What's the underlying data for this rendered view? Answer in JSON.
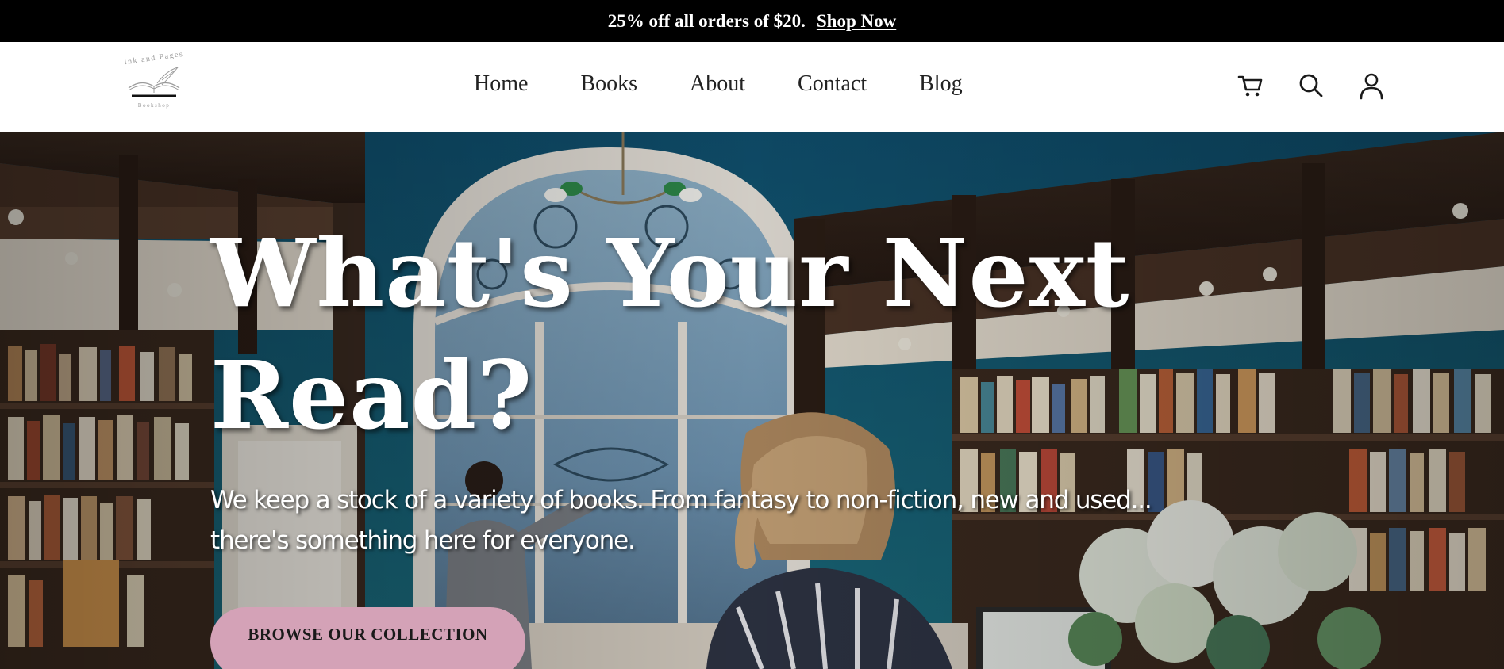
{
  "promo": {
    "text": "25% off all orders of $20.",
    "link": "Shop Now"
  },
  "header": {
    "logo": {
      "top_text": "Ink and Pages",
      "bottom_text": "Bookshop"
    },
    "nav": [
      {
        "label": "Home"
      },
      {
        "label": "Books"
      },
      {
        "label": "About"
      },
      {
        "label": "Contact"
      },
      {
        "label": "Blog"
      }
    ],
    "icons": [
      "cart-icon",
      "search-icon",
      "account-icon"
    ]
  },
  "hero": {
    "title_line1": "What's Your Next",
    "title_line2": "Read?",
    "subtitle_line1": "We keep a stock of a variety of books. From fantasy to non-fiction, new and used...",
    "subtitle_line2": "there's something here for everyone.",
    "button": "BROWSE OUR COLLECTION"
  },
  "colors": {
    "promo_bg": "#000000",
    "button_bg": "#d4a2b7",
    "text_light": "#ffffff",
    "nav_text": "#222222"
  }
}
